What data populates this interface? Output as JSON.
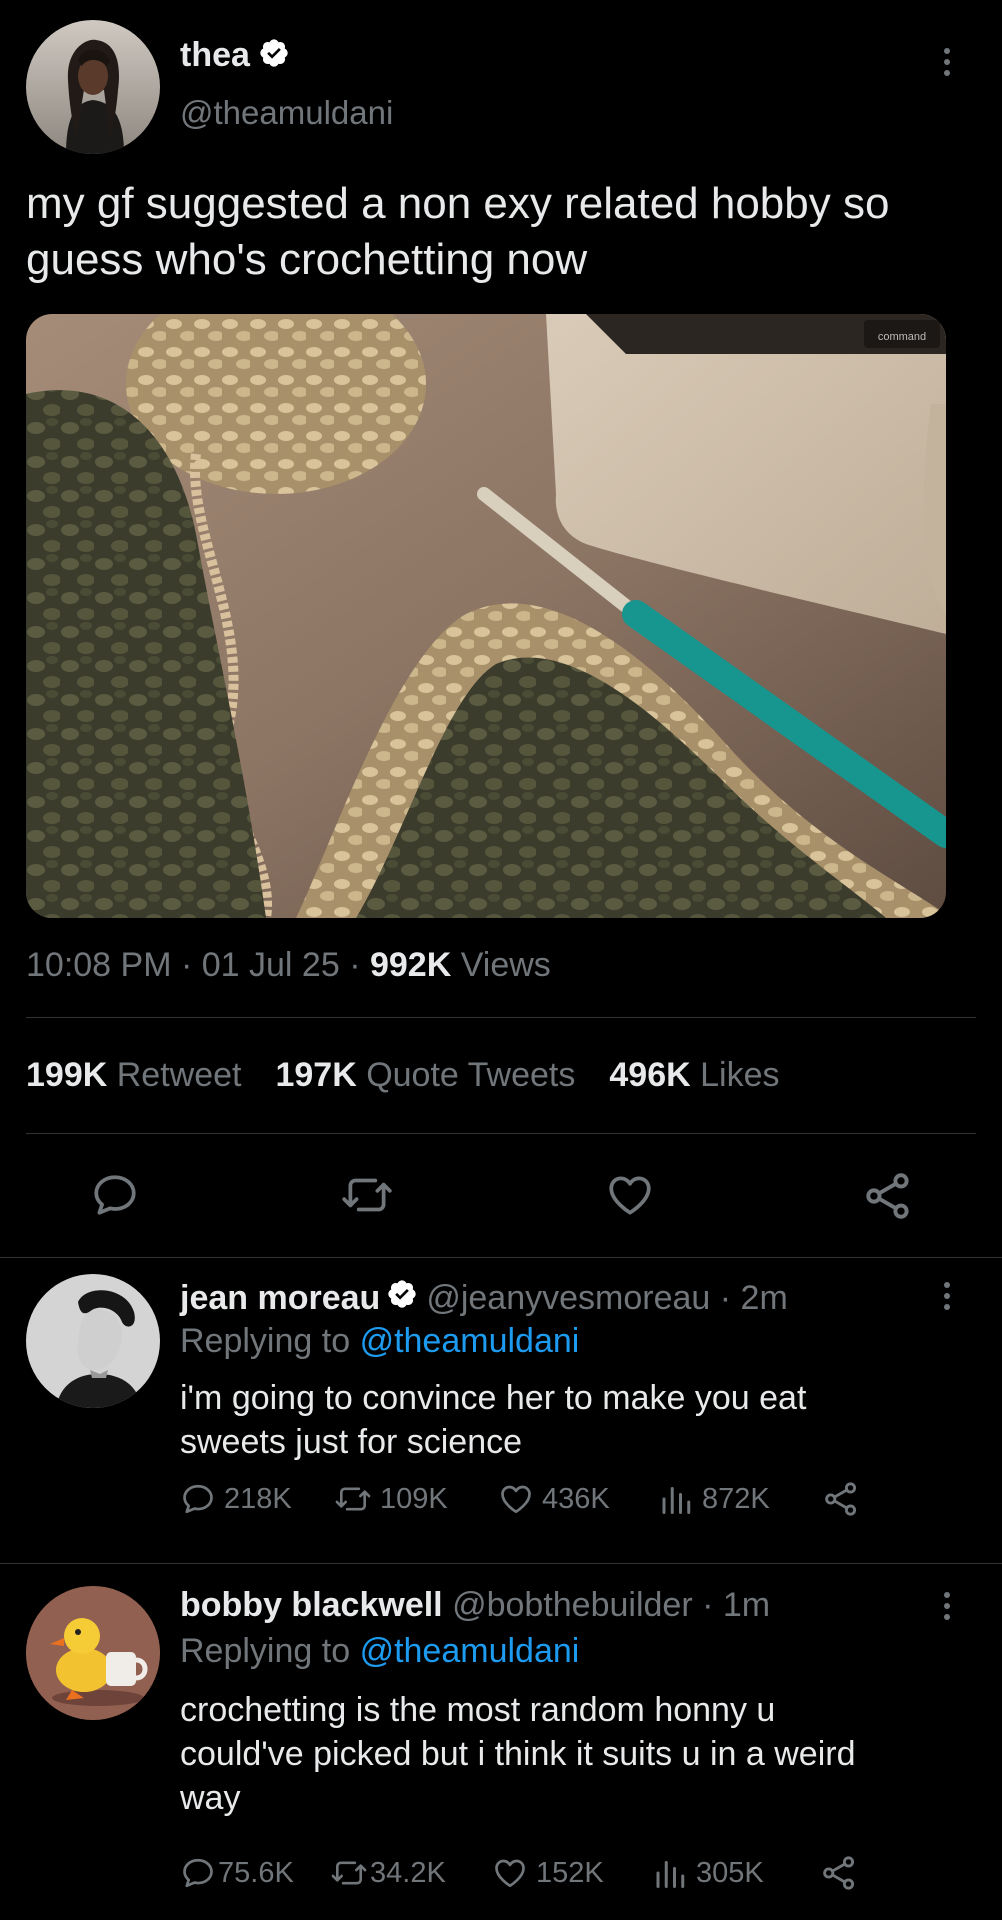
{
  "main_tweet": {
    "display_name": "thea",
    "handle": "@theamuldani",
    "text_line1": "my gf suggested a non exy related hobby so",
    "text_line2": "guess who's crochetting now",
    "time": "10:08 PM",
    "date": "01 Jul 25",
    "views_count": "992K",
    "views_label": "Views",
    "retweets_count": "199K",
    "retweets_label": "Retweet",
    "quotes_count": "197K",
    "quotes_label": "Quote Tweets",
    "likes_count": "496K",
    "likes_label": "Likes",
    "image_keyboard_text": "command"
  },
  "replies": [
    {
      "display_name": "jean moreau",
      "handle": "@jeanyvesmoreau",
      "time": "2m",
      "replying_prefix": "Replying to",
      "replying_to": "@theamuldani",
      "text_line1": "i'm going to convince her to make you eat",
      "text_line2": "sweets just for science",
      "text_line3": "",
      "replies_count": "218K",
      "retweets_count": "109K",
      "likes_count": "436K",
      "views_count": "872K"
    },
    {
      "display_name": "bobby blackwell",
      "handle": "@bobthebuilder",
      "time": "1m",
      "replying_prefix": "Replying to",
      "replying_to": "@theamuldani",
      "text_line1": "crochetting is the most random honny u",
      "text_line2": "could've picked but i think it suits u in a weird",
      "text_line3": "way",
      "replies_count": "75.6K",
      "retweets_count": "34.2K",
      "likes_count": "152K",
      "views_count": "305K"
    }
  ],
  "colors": {
    "background": "#000000",
    "text": "#e7e9ea",
    "muted": "#71767b",
    "accent": "#1d9bf0",
    "divider": "#2f3336"
  }
}
